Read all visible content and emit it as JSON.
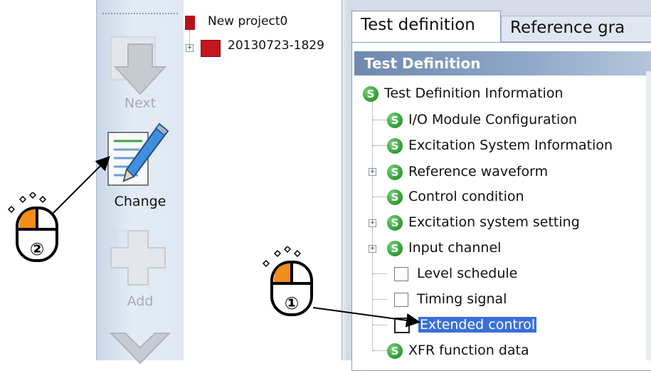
{
  "toolbar": {
    "next_label": "Next",
    "change_label": "Change",
    "add_label": "Add"
  },
  "project_tree": {
    "root": "New project0",
    "child": "20130723-1829"
  },
  "tabs": {
    "test_definition": "Test definition",
    "reference": "Reference gra"
  },
  "section_header": "Test Definition",
  "tree": {
    "root": "Test Definition Information",
    "items": [
      "I/O Module Configuration",
      "Excitation System Information",
      "Reference waveform",
      "Control condition",
      "Excitation system setting",
      "Input channel",
      "Level schedule",
      "Timing signal",
      "Extended control",
      "XFR function data"
    ]
  },
  "annotations": {
    "step1": "①",
    "step2": "②"
  },
  "colors": {
    "selection": "#3a6fd8",
    "mouse_button": "#f28c1a",
    "header": "#6e89ad"
  }
}
